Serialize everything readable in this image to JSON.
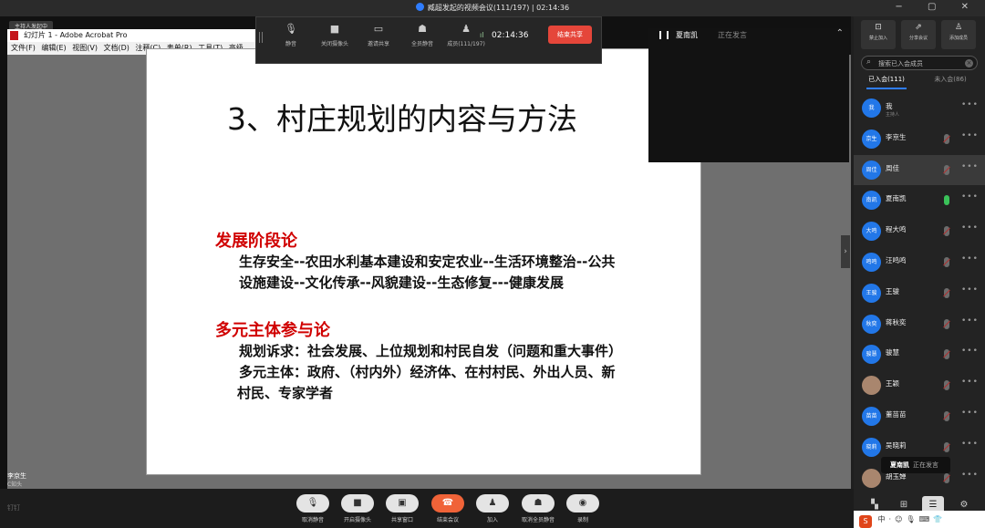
{
  "window": {
    "title": "臧超发起的视频会议(111/197) | 02:14:36"
  },
  "stage": {
    "host_tag": "主持人发起中",
    "acrobat_title": "幻灯片 1 - Adobe Acrobat Pro",
    "acrobat_menu": "文件(F) 编辑(E) 视图(V) 文档(D) 注释(C) 表单(R) 工具(T) 高级",
    "presenter": "李京生",
    "presenter_sub": "C知头"
  },
  "meeting_bar": {
    "items": [
      "静音",
      "关闭摄像头",
      "邀请共享",
      "全员静音",
      "成员(111/197)"
    ],
    "time": "02:14:36",
    "end_label": "结束共享"
  },
  "slide": {
    "title": "3、村庄规划的内容与方法",
    "heading1": "发展阶段论",
    "body1_line1": "生存安全--农田水利基本建设和安定农业--生活环境整治--公共",
    "body1_line2": "设施建设--文化传承--风貌建设--生态修复---健康发展",
    "heading2": "多元主体参与论",
    "body2_line1": "规划诉求：社会发展、上位规划和村民自发（问题和重大事件）",
    "body2_line2": "多元主体：政府、（村内外）经济体、在村村民、外出人员、新",
    "body2_line3": "村民、专家学者"
  },
  "speaker_tile": {
    "name": "夏南凯",
    "state": "正在发言"
  },
  "sidebar": {
    "top_buttons": [
      "禁止加入",
      "分享会议",
      "添加成员"
    ],
    "search_placeholder": "搜索已入会成员",
    "tabs": {
      "joined": "已入会(111)",
      "not_joined": "未入会(86)"
    },
    "participants": [
      {
        "name": "我",
        "role": "主持人",
        "avatar": "我",
        "mic": "none"
      },
      {
        "name": "李京生",
        "role": "",
        "avatar": "京生",
        "mic": "muted"
      },
      {
        "name": "周佳",
        "role": "",
        "avatar": "周佳",
        "mic": "muted"
      },
      {
        "name": "夏南凯",
        "role": "",
        "avatar": "南凯",
        "mic": "on"
      },
      {
        "name": "程大鸣",
        "role": "",
        "avatar": "大鸣",
        "mic": "muted"
      },
      {
        "name": "汪鸣鸣",
        "role": "",
        "avatar": "鸣鸣",
        "mic": "muted"
      },
      {
        "name": "王骏",
        "role": "",
        "avatar": "王骏",
        "mic": "muted"
      },
      {
        "name": "蒋秋奕",
        "role": "",
        "avatar": "秋奕",
        "mic": "muted"
      },
      {
        "name": "骏慧",
        "role": "",
        "avatar": "骏慧",
        "mic": "muted"
      },
      {
        "name": "王颖",
        "role": "",
        "avatar": "",
        "mic": "muted"
      },
      {
        "name": "董苗苗",
        "role": "",
        "avatar": "苗苗",
        "mic": "muted"
      },
      {
        "name": "吴晓莉",
        "role": "",
        "avatar": "晓莉",
        "mic": "muted"
      },
      {
        "name": "胡玉婵",
        "role": "",
        "avatar": "",
        "mic": "muted"
      }
    ],
    "tooltip": {
      "name": "夏南凯",
      "state": "正在发言"
    }
  },
  "bottom_bar": {
    "logo": "钉钉",
    "items": [
      "取消静音",
      "开启摄像头",
      "共享窗口",
      "结束会议",
      "加入",
      "取消全员静音",
      "录制"
    ]
  }
}
